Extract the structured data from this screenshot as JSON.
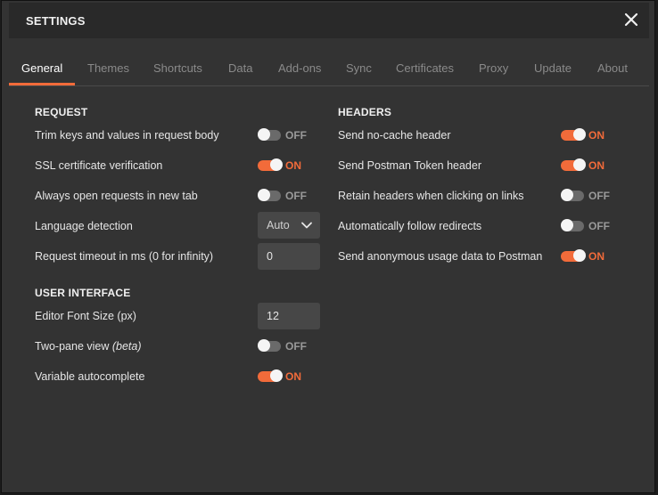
{
  "modal": {
    "title": "SETTINGS"
  },
  "tabs": [
    {
      "label": "General",
      "active": true
    },
    {
      "label": "Themes"
    },
    {
      "label": "Shortcuts"
    },
    {
      "label": "Data"
    },
    {
      "label": "Add-ons"
    },
    {
      "label": "Sync"
    },
    {
      "label": "Certificates"
    },
    {
      "label": "Proxy"
    },
    {
      "label": "Update"
    },
    {
      "label": "About"
    }
  ],
  "request": {
    "title": "REQUEST",
    "trim_keys": {
      "label": "Trim keys and values in request body",
      "state": "OFF"
    },
    "ssl_verification": {
      "label": "SSL certificate verification",
      "state": "ON"
    },
    "open_new_tab": {
      "label": "Always open requests in new tab",
      "state": "OFF"
    },
    "language_detection": {
      "label": "Language detection",
      "value": "Auto"
    },
    "timeout": {
      "label": "Request timeout in ms (0 for infinity)",
      "value": "0"
    }
  },
  "user_interface": {
    "title": "USER INTERFACE",
    "font_size": {
      "label": "Editor Font Size (px)",
      "value": "12"
    },
    "two_pane": {
      "label": "Two-pane view",
      "label_suffix": "(beta)",
      "state": "OFF"
    },
    "variable_autocomplete": {
      "label": "Variable autocomplete",
      "state": "ON"
    }
  },
  "headers": {
    "title": "HEADERS",
    "no_cache": {
      "label": "Send no-cache header",
      "state": "ON"
    },
    "postman_token": {
      "label": "Send Postman Token header",
      "state": "ON"
    },
    "retain_headers": {
      "label": "Retain headers when clicking on links",
      "state": "OFF"
    },
    "follow_redirects": {
      "label": "Automatically follow redirects",
      "state": "OFF"
    },
    "anonymous_usage": {
      "label": "Send anonymous usage data to Postman",
      "state": "ON"
    }
  },
  "colors": {
    "accent": "#f26b3a",
    "background": "#333333",
    "titlebar": "#292929"
  }
}
